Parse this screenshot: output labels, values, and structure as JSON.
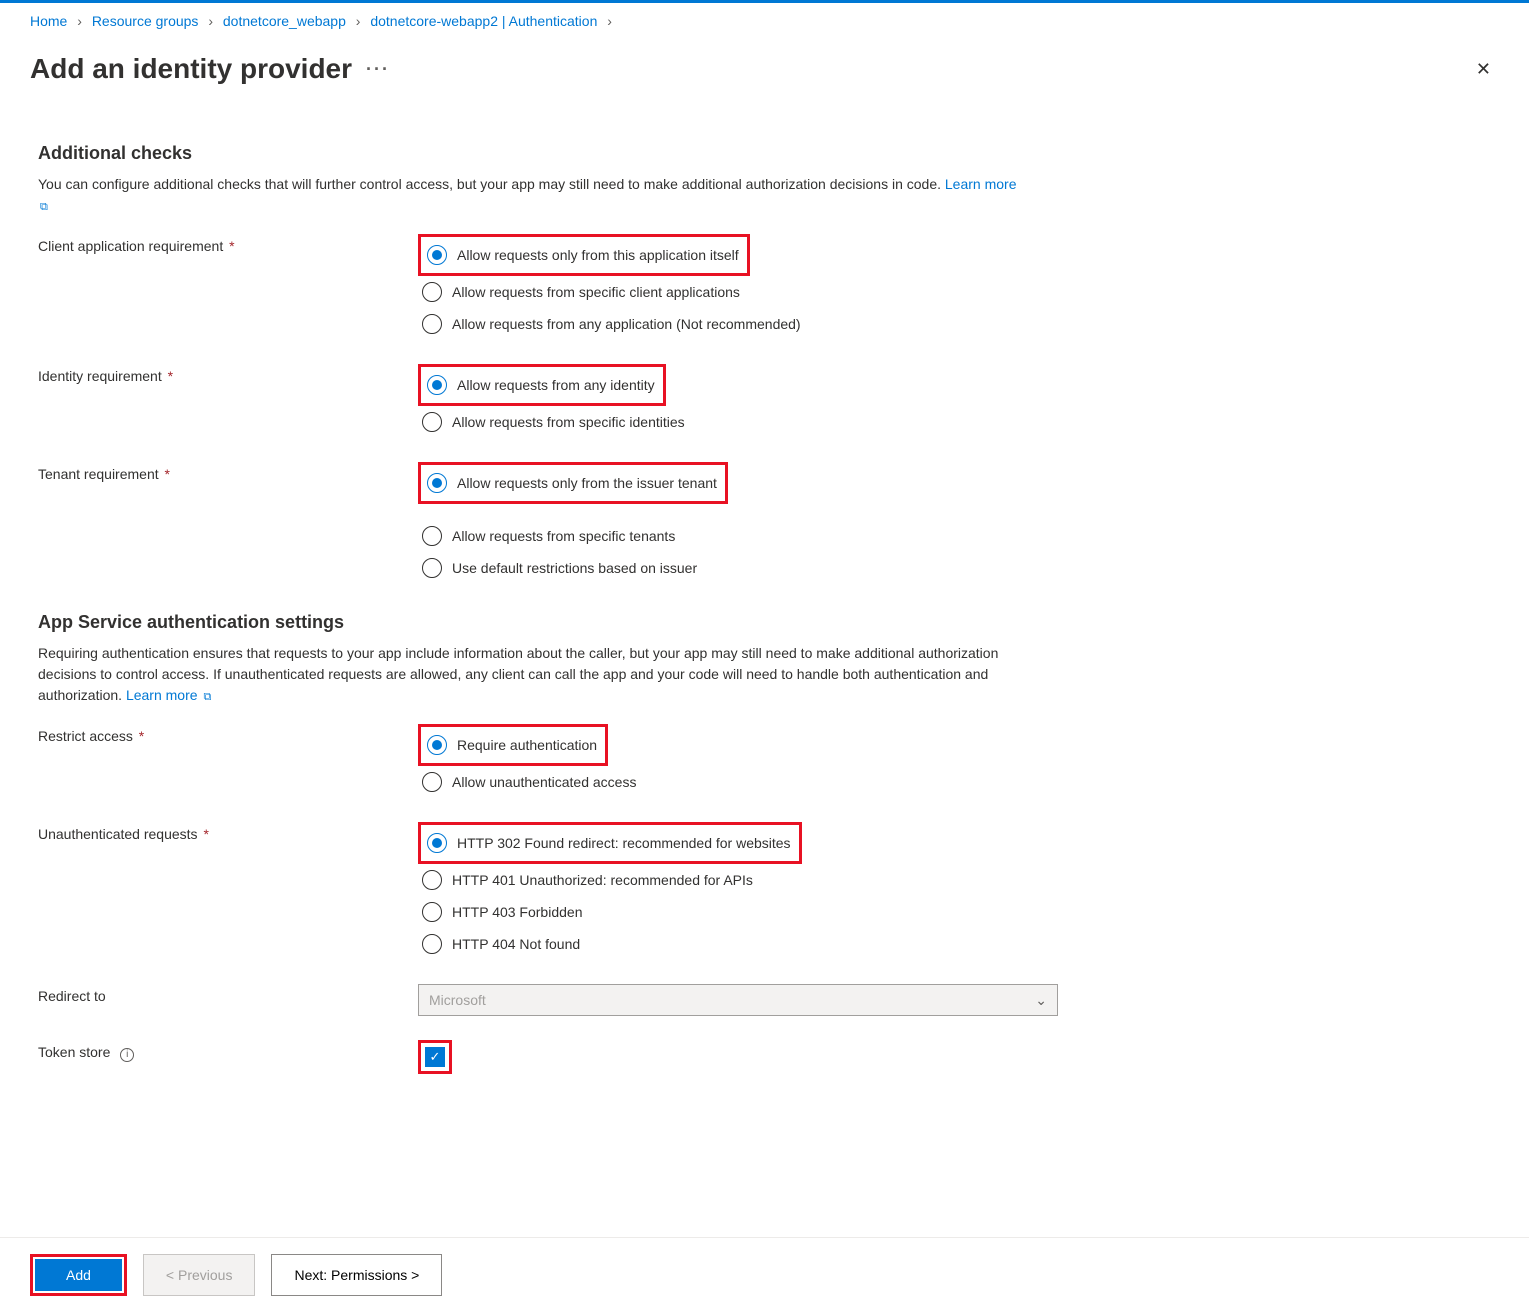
{
  "breadcrumb": {
    "items": [
      {
        "label": "Home"
      },
      {
        "label": "Resource groups"
      },
      {
        "label": "dotnetcore_webapp"
      },
      {
        "label": "dotnetcore-webapp2 | Authentication"
      }
    ]
  },
  "header": {
    "title": "Add an identity provider"
  },
  "section_checks": {
    "heading": "Additional checks",
    "desc": "You can configure additional checks that will further control access, but your app may still need to make additional authorization decisions in code.",
    "learn_more": "Learn more"
  },
  "field_client_app": {
    "label": "Client application requirement",
    "opt1": "Allow requests only from this application itself",
    "opt2": "Allow requests from specific client applications",
    "opt3": "Allow requests from any application (Not recommended)"
  },
  "field_identity": {
    "label": "Identity requirement",
    "opt1": "Allow requests from any identity",
    "opt2": "Allow requests from specific identities"
  },
  "field_tenant": {
    "label": "Tenant requirement",
    "opt1": "Allow requests only from the issuer tenant",
    "opt2": "Allow requests from specific tenants",
    "opt3": "Use default restrictions based on issuer"
  },
  "section_auth": {
    "heading": "App Service authentication settings",
    "desc": "Requiring authentication ensures that requests to your app include information about the caller, but your app may still need to make additional authorization decisions to control access. If unauthenticated requests are allowed, any client can call the app and your code will need to handle both authentication and authorization.",
    "learn_more": "Learn more"
  },
  "field_restrict": {
    "label": "Restrict access",
    "opt1": "Require authentication",
    "opt2": "Allow unauthenticated access"
  },
  "field_unauth": {
    "label": "Unauthenticated requests",
    "opt1": "HTTP 302 Found redirect: recommended for websites",
    "opt2": "HTTP 401 Unauthorized: recommended for APIs",
    "opt3": "HTTP 403 Forbidden",
    "opt4": "HTTP 404 Not found"
  },
  "field_redirect": {
    "label": "Redirect to",
    "value": "Microsoft"
  },
  "field_token": {
    "label": "Token store"
  },
  "footer": {
    "add": "Add",
    "previous": "< Previous",
    "next": "Next: Permissions >"
  }
}
